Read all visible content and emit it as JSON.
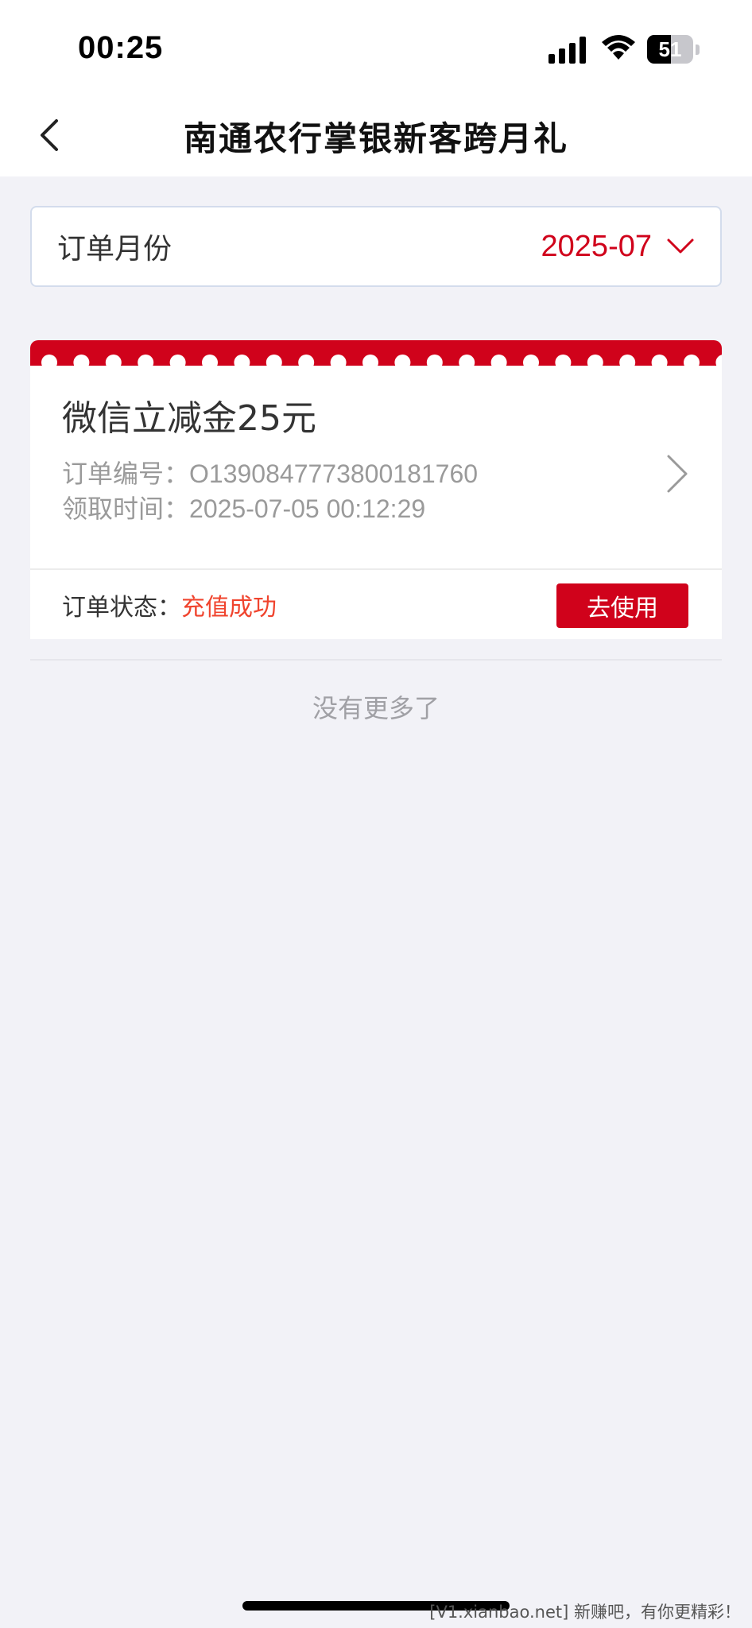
{
  "status_bar": {
    "time": "00:25",
    "battery_level": "51",
    "battery_fraction": 0.51
  },
  "nav": {
    "title": "南通农行掌银新客跨月礼",
    "back_icon": "chevron-left-icon"
  },
  "filter": {
    "label": "订单月份",
    "value": "2025-07",
    "dropdown_icon": "chevron-down-icon"
  },
  "orders": [
    {
      "title": "微信立减金25元",
      "order_no_label": "订单编号：",
      "order_no": "O1390847773800181760",
      "claim_time_label": "领取时间：",
      "claim_time": "2025-07-05 00:12:29",
      "status_label": "订单状态：",
      "status": "充值成功",
      "action_label": "去使用"
    }
  ],
  "list_footer": "没有更多了",
  "watermark": "[V1.xianbao.net] 新赚吧，有你更精彩！",
  "colors": {
    "accent": "#d0021b",
    "status_success": "#f0442e",
    "background": "#f2f2f7",
    "muted_text": "#9a9a9a"
  }
}
